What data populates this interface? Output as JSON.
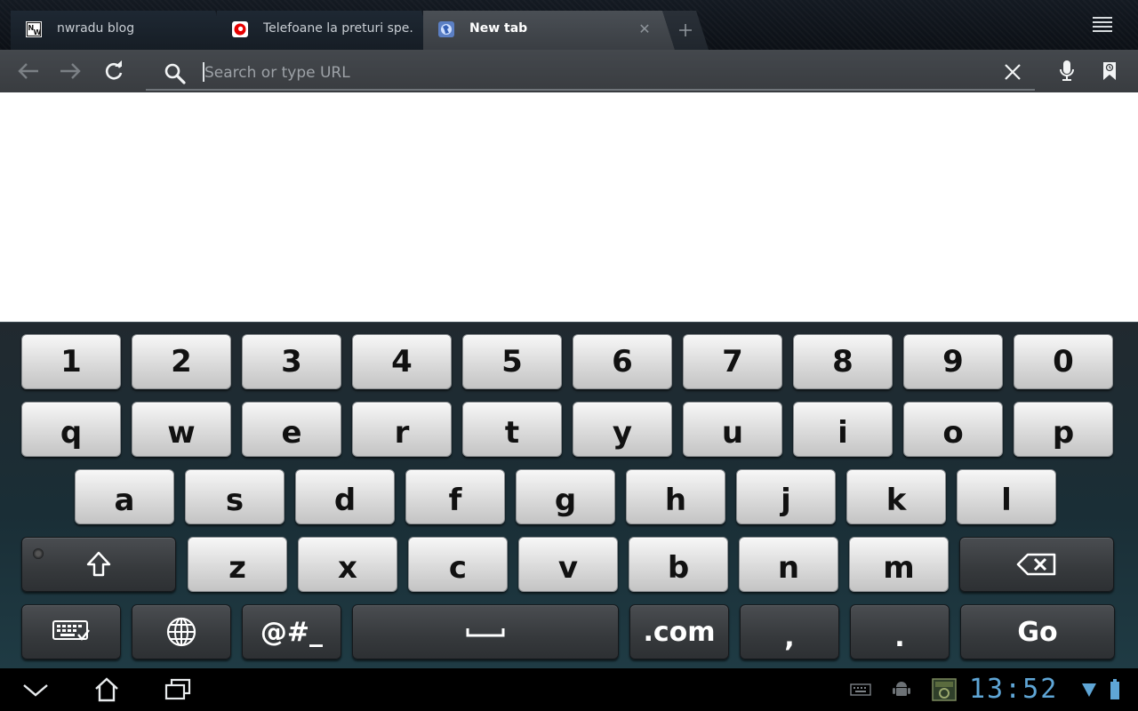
{
  "tabs": [
    {
      "title": "nwradu blog",
      "favicon": "nw-favicon-icon"
    },
    {
      "title": "Telefoane la preturi spe...",
      "favicon": "vodafone-favicon-icon"
    },
    {
      "title": "New tab",
      "favicon": "globe-favicon-icon",
      "active": true
    }
  ],
  "toolbar": {
    "url_placeholder": "Search or type URL",
    "url_value": ""
  },
  "keyboard": {
    "row_numbers": [
      "1",
      "2",
      "3",
      "4",
      "5",
      "6",
      "7",
      "8",
      "9",
      "0"
    ],
    "row_top": [
      "q",
      "w",
      "e",
      "r",
      "t",
      "y",
      "u",
      "i",
      "o",
      "p"
    ],
    "row_middle": [
      "a",
      "s",
      "d",
      "f",
      "g",
      "h",
      "j",
      "k",
      "l"
    ],
    "row_bottom": [
      "z",
      "x",
      "c",
      "v",
      "b",
      "n",
      "m"
    ],
    "symbols_label": "@#_",
    "dotcom_label": ".com",
    "comma_label": ",",
    "period_label": ".",
    "go_label": "Go"
  },
  "system_bar": {
    "clock": "13:52"
  },
  "colors": {
    "clock": "#5fa6d6",
    "tab_active": "#44484d",
    "content_bg": "#ffffff"
  }
}
